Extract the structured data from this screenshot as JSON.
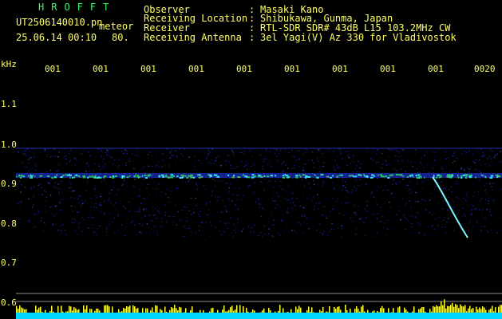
{
  "header": {
    "brand": "HROFFT",
    "filename": "UT2506140010.pn",
    "tag": "meteor",
    "datetime": "25.06.14 00:10",
    "number": "80.",
    "fields": [
      {
        "label": "Observer",
        "sep": ":",
        "value": "Masaki Kano"
      },
      {
        "label": "Receiving Location",
        "sep": ":",
        "value": "Shibukawa, Gunma, Japan"
      },
      {
        "label": "Receiver",
        "sep": ":",
        "value": "RTL-SDR SDR# 43dB L15 103.2MHz CW"
      },
      {
        "label": "Receiving Antenna",
        "sep": ":",
        "value": "3el Yagi(V) Az 330 for Vladivostok"
      }
    ]
  },
  "axis": {
    "unit": "kHz",
    "y_ticks": [
      "1.1",
      "1.0",
      "0.9",
      "0.8",
      "0.7",
      "0.6"
    ],
    "time_ticks": [
      "001",
      "001",
      "001",
      "001",
      "001",
      "001",
      "001",
      "001",
      "001",
      "0020"
    ]
  },
  "colors": {
    "background": "#000000",
    "text": "#ffff66",
    "brand": "#33ff66",
    "carrier": "#40e0ff",
    "noise": "#1a2ad0",
    "meteor": "#7ff8ff",
    "bars": "#ffff33",
    "baseline": "#00d8ff"
  },
  "spectrogram": {
    "carrier_khz": 0.92,
    "band_khz": [
      0.77,
      0.99
    ],
    "meteor_echo": {
      "t_start": 0.855,
      "t_end": 0.915,
      "f_start_khz": 0.915,
      "f_end_khz": 0.765
    }
  }
}
